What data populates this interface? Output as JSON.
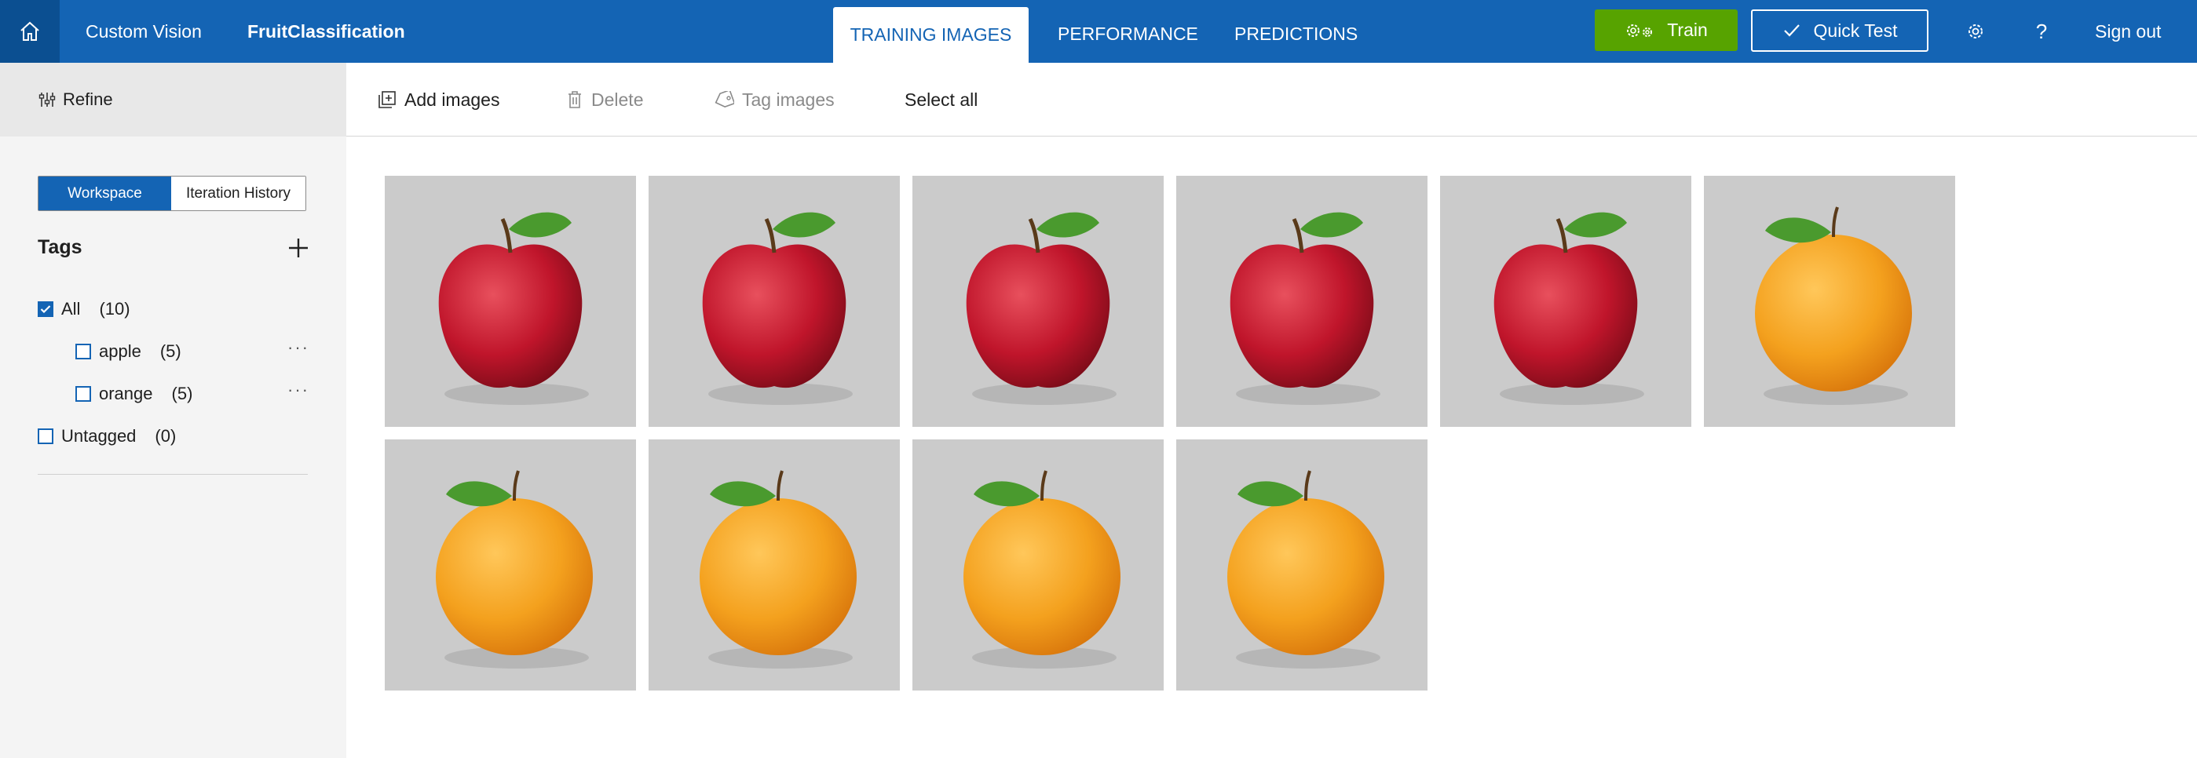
{
  "app": {
    "brand": "Custom Vision",
    "project": "FruitClassification"
  },
  "tabs": [
    {
      "label": "TRAINING IMAGES",
      "active": true
    },
    {
      "label": "PERFORMANCE",
      "active": false
    },
    {
      "label": "PREDICTIONS",
      "active": false
    }
  ],
  "header_actions": {
    "train_label": "Train",
    "quick_test_label": "Quick Test",
    "sign_out_label": "Sign out",
    "settings_icon": "gear-icon",
    "help_label": "?"
  },
  "sidebar": {
    "refine_label": "Refine",
    "segment": [
      "Workspace",
      "Iteration History"
    ],
    "tags_title": "Tags",
    "tags": [
      {
        "name": "All",
        "count": "(10)",
        "checked": true
      },
      {
        "name": "apple",
        "count": "(5)",
        "checked": false
      },
      {
        "name": "orange",
        "count": "(5)",
        "checked": false
      },
      {
        "name": "Untagged",
        "count": "(0)",
        "checked": false
      }
    ],
    "more_label": "···"
  },
  "toolbar": {
    "add_images": "Add images",
    "delete": "Delete",
    "tag_images": "Tag images",
    "select_all": "Select all"
  },
  "images": [
    {
      "fruit": "apple"
    },
    {
      "fruit": "apple"
    },
    {
      "fruit": "apple"
    },
    {
      "fruit": "apple"
    },
    {
      "fruit": "apple"
    },
    {
      "fruit": "orange"
    },
    {
      "fruit": "orange"
    },
    {
      "fruit": "orange"
    },
    {
      "fruit": "orange"
    },
    {
      "fruit": "orange"
    }
  ],
  "colors": {
    "header": "#1464b4",
    "home": "#0b4f91",
    "train": "#57a300",
    "apple": "#c0152b",
    "orange": "#f4a11e",
    "leaf": "#4a9a2e"
  }
}
